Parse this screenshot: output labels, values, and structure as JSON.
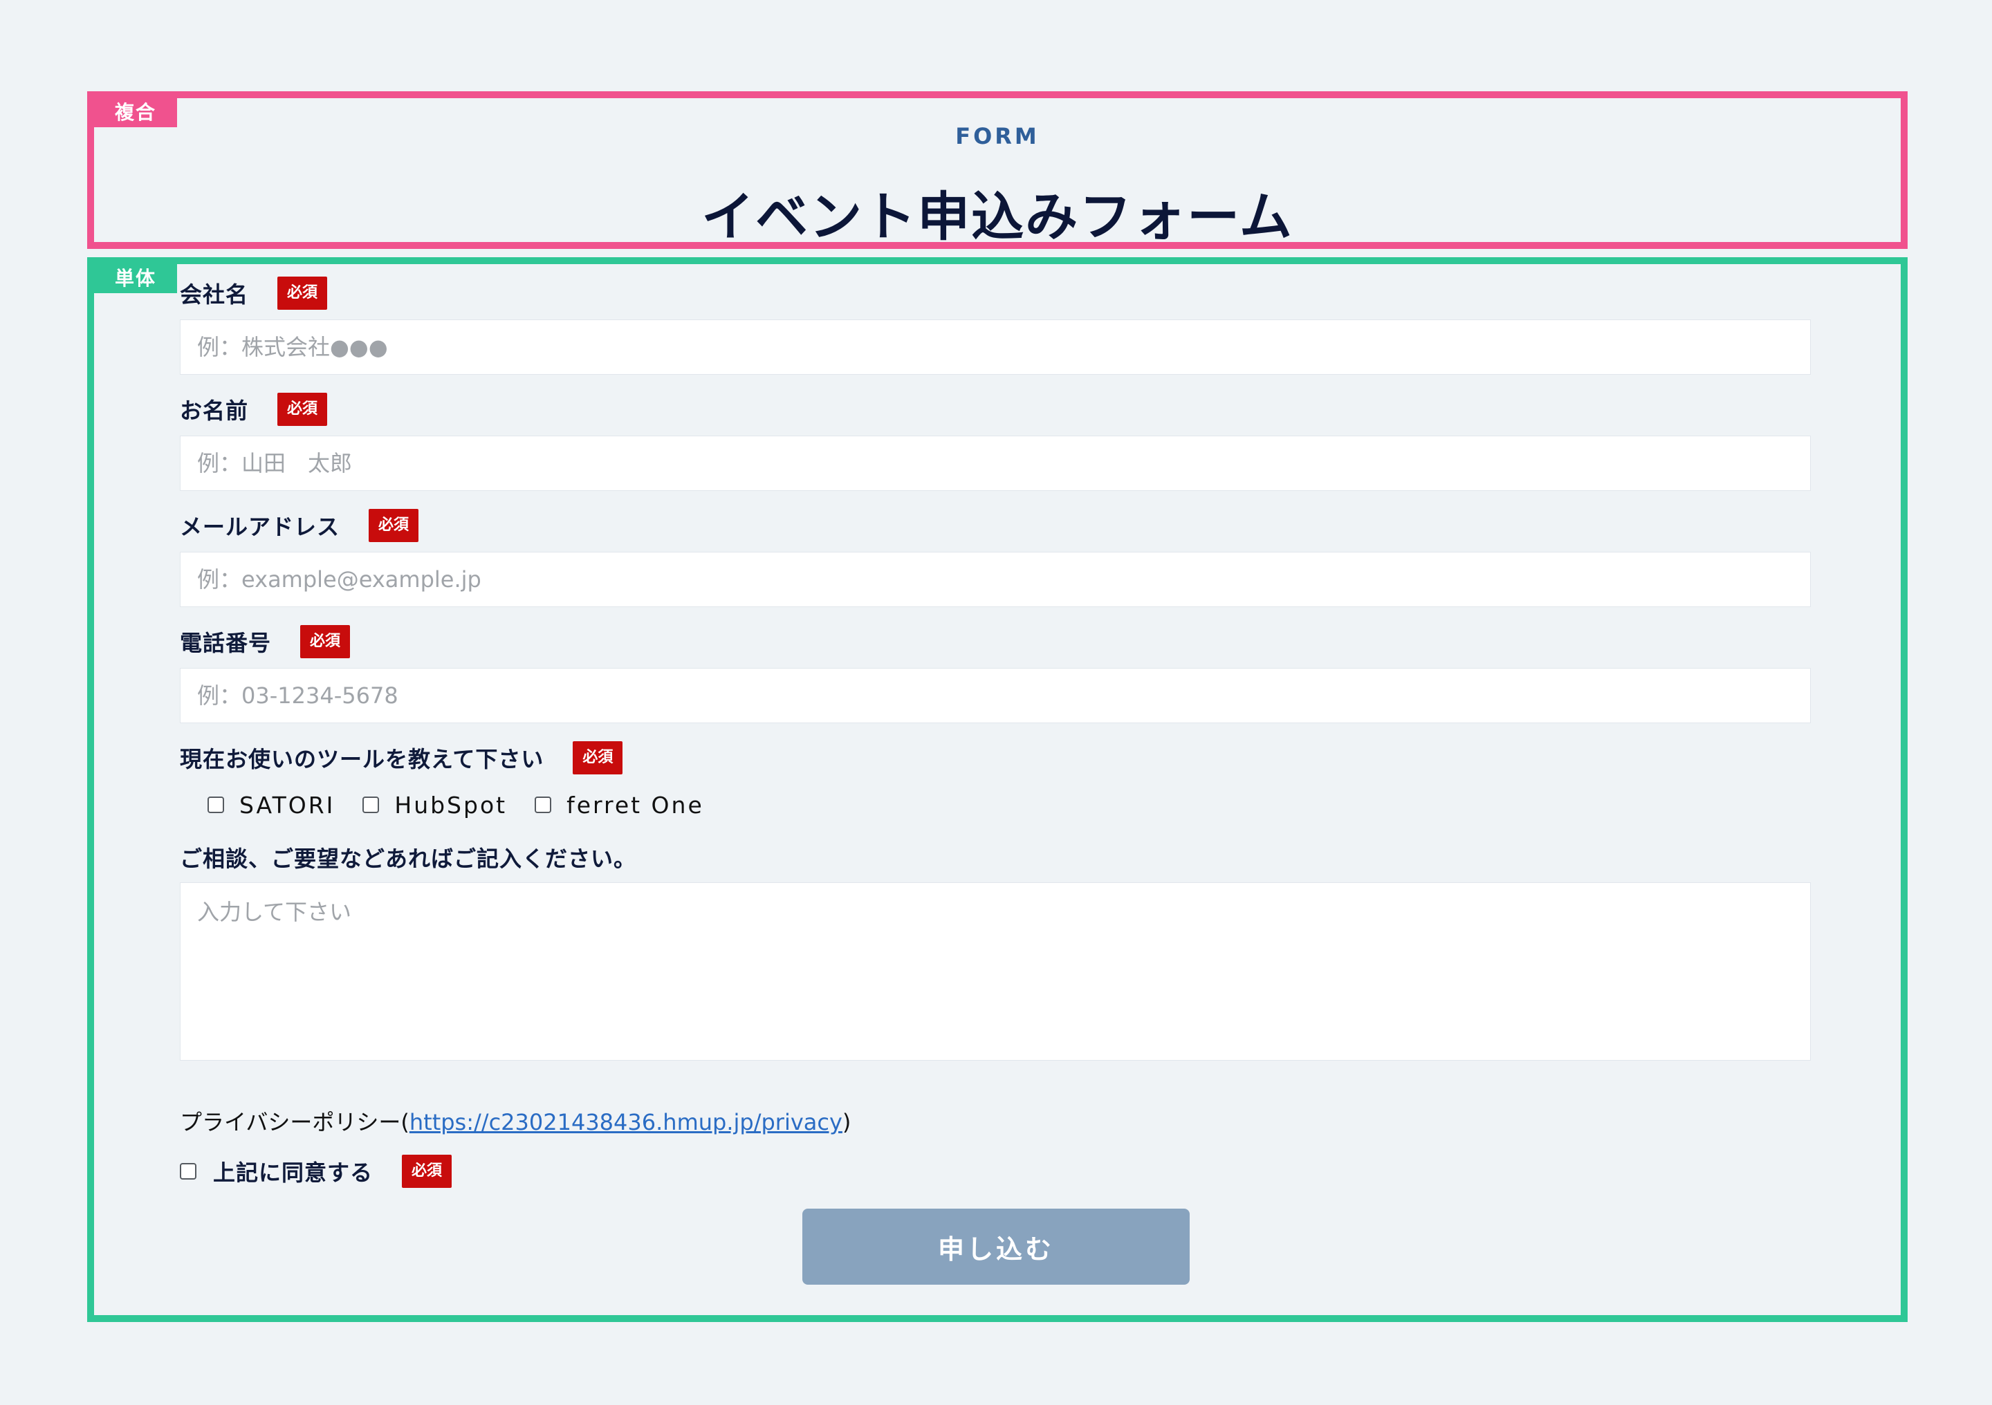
{
  "sections": {
    "composite_tag": "複合",
    "single_tag": "単体"
  },
  "header": {
    "eyebrow": "FORM",
    "title": "イベント申込みフォーム"
  },
  "form": {
    "required_badge": "必須",
    "company": {
      "label": "会社名",
      "placeholder": "例：株式会社●●●"
    },
    "name": {
      "label": "お名前",
      "placeholder": "例：山田　太郎"
    },
    "email": {
      "label": "メールアドレス",
      "placeholder": "例：example@example.jp"
    },
    "phone": {
      "label": "電話番号",
      "placeholder": "例：03-1234-5678"
    },
    "tools": {
      "label": "現在お使いのツールを教えて下さい",
      "options": [
        "SATORI",
        "HubSpot",
        "ferret One"
      ]
    },
    "consultation": {
      "label": "ご相談、ご要望などあればご記入ください。",
      "placeholder": "入力して下さい"
    },
    "privacy": {
      "prefix": "プライバシーポリシー(",
      "link": "https://c23021438436.hmup.jp/privacy",
      "suffix": ")"
    },
    "agree": {
      "label": "上記に同意する"
    },
    "submit_label": "申し込む"
  }
}
